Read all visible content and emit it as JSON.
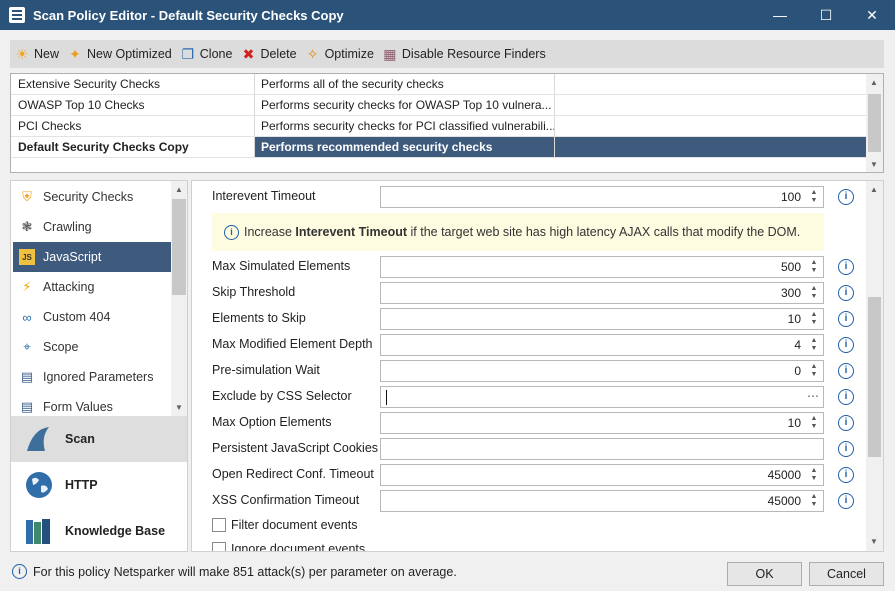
{
  "window": {
    "title": "Scan Policy Editor - Default Security Checks Copy",
    "title_bg": "#2b5379"
  },
  "toolbar": {
    "items": [
      {
        "label": "New",
        "icon": "sun-new-icon",
        "color": "#f5a31a"
      },
      {
        "label": "New Optimized",
        "icon": "wand-new-icon",
        "color": "#e9a020"
      },
      {
        "label": "Clone",
        "icon": "clone-icon",
        "color": "#2d6cb0"
      },
      {
        "label": "Delete",
        "icon": "delete-x-icon",
        "color": "#d32020"
      },
      {
        "label": "Optimize",
        "icon": "magic-wand-icon",
        "color": "#e08a12"
      },
      {
        "label": "Disable Resource Finders",
        "icon": "disable-finders-icon",
        "color": "#8a5a6a"
      }
    ]
  },
  "policies": [
    {
      "name": "Extensive Security Checks",
      "description": "Performs all of the security checks"
    },
    {
      "name": "OWASP Top 10 Checks",
      "description": "Performs security checks for OWASP Top 10 vulnera..."
    },
    {
      "name": "PCI Checks",
      "description": "Performs security checks for PCI classified vulnerabili..."
    },
    {
      "name": "Default Security Checks Copy",
      "description": "Performs recommended security checks",
      "selected": true
    }
  ],
  "nav": {
    "items": [
      {
        "label": "Security Checks",
        "icon": "shield-icon"
      },
      {
        "label": "Crawling",
        "icon": "spider-icon"
      },
      {
        "label": "JavaScript",
        "icon": "js-icon",
        "active": true
      },
      {
        "label": "Attacking",
        "icon": "lightning-icon"
      },
      {
        "label": "Custom 404",
        "icon": "broken-link-icon"
      },
      {
        "label": "Scope",
        "icon": "crosshair-icon"
      },
      {
        "label": "Ignored Parameters",
        "icon": "ignored-list-icon"
      },
      {
        "label": "Form Values",
        "icon": "form-values-icon"
      }
    ],
    "groups": [
      {
        "label": "Scan",
        "icon": "shark-fin-icon",
        "active": true
      },
      {
        "label": "HTTP",
        "icon": "globe-icon"
      },
      {
        "label": "Knowledge Base",
        "icon": "books-icon"
      }
    ]
  },
  "settings": {
    "interevent_timeout": {
      "label": "Interevent Timeout",
      "value": "100"
    },
    "note": {
      "prefix": "Increase ",
      "bold": "Interevent Timeout",
      "suffix": " if the target web site has high latency AJAX calls that modify the DOM."
    },
    "fields": [
      {
        "label": "Max Simulated Elements",
        "value": "500",
        "kind": "spin"
      },
      {
        "label": "Skip Threshold",
        "value": "300",
        "kind": "spin"
      },
      {
        "label": "Elements to Skip",
        "value": "10",
        "kind": "spin"
      },
      {
        "label": "Max Modified Element Depth",
        "value": "4",
        "kind": "spin"
      },
      {
        "label": "Pre-simulation Wait",
        "value": "0",
        "kind": "spin"
      },
      {
        "label": "Exclude by CSS Selector",
        "value": "",
        "kind": "text-ellipsis"
      },
      {
        "label": "Max Option Elements",
        "value": "10",
        "kind": "spin"
      },
      {
        "label": "Persistent JavaScript Cookies",
        "value": "",
        "kind": "text"
      },
      {
        "label": "Open Redirect Conf. Timeout",
        "value": "45000",
        "kind": "spin"
      },
      {
        "label": "XSS Confirmation Timeout",
        "value": "45000",
        "kind": "spin"
      }
    ],
    "checkboxes": [
      {
        "label": "Filter document events",
        "checked": false
      },
      {
        "label": "Ignore document events",
        "checked": false
      }
    ]
  },
  "status": {
    "text": "For this policy Netsparker will make 851 attack(s) per parameter on average."
  },
  "buttons": {
    "ok": "OK",
    "cancel": "Cancel"
  }
}
